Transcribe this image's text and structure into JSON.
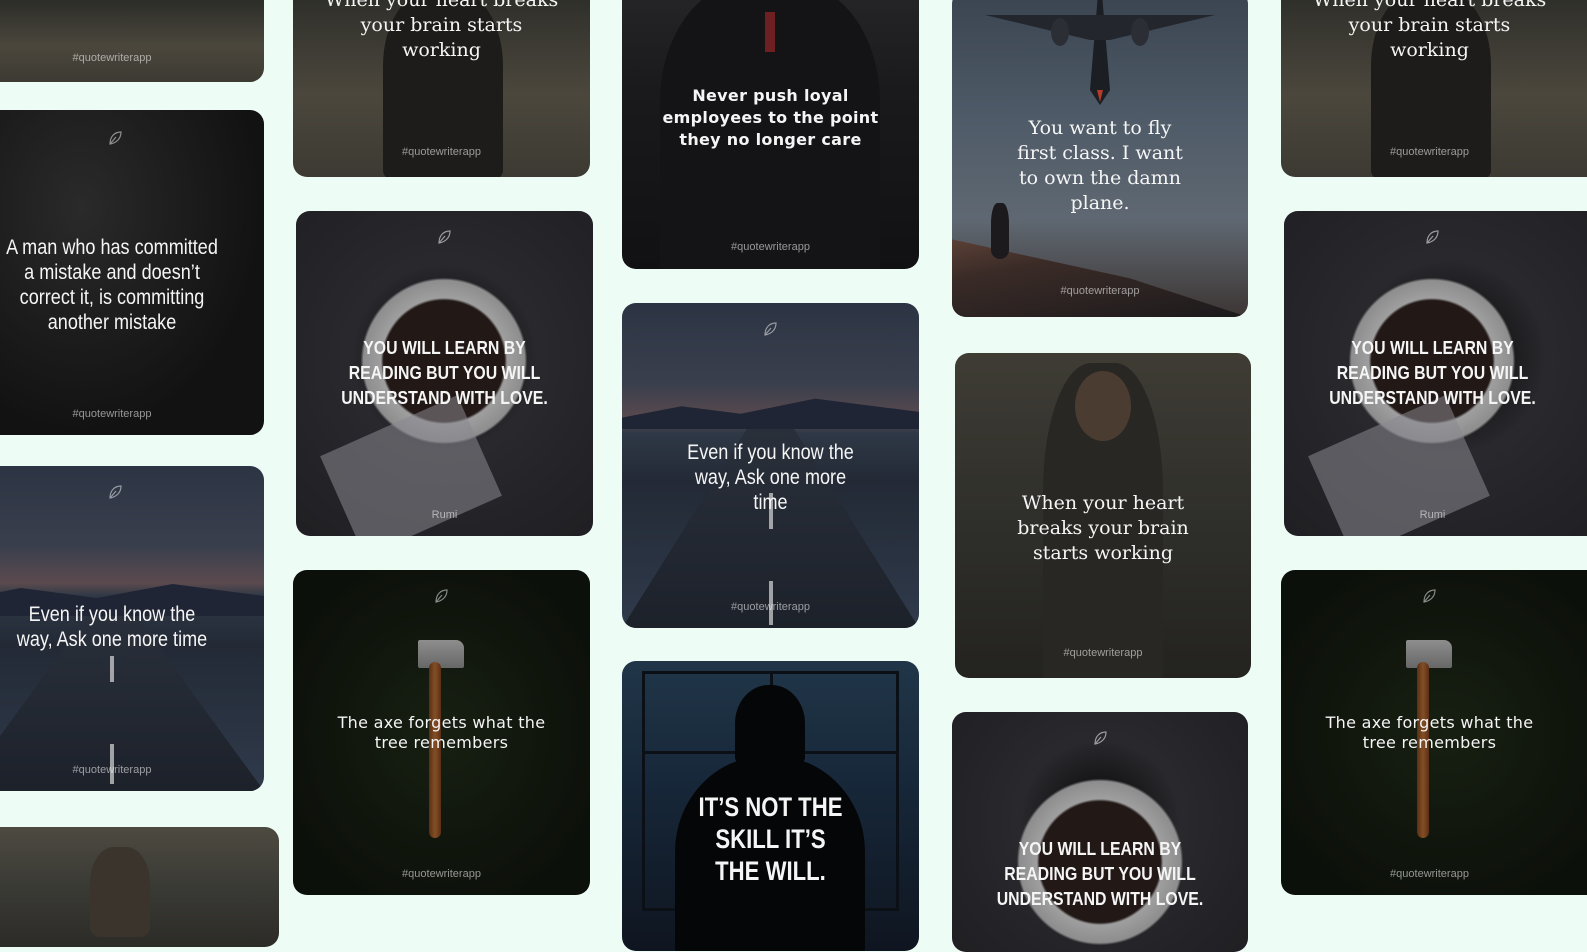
{
  "brand_tag": "#quotewriterapp",
  "cards": {
    "c1": {
      "text": "",
      "tag": "#quotewriterapp"
    },
    "c2": {
      "text": "A man who has committed a mistake and doesn’t correct it, is committing another mistake",
      "tag": "#quotewriterapp"
    },
    "c3": {
      "text": "Even if you know the way, Ask one more time",
      "tag": "#quotewriterapp"
    },
    "c4": {
      "text": "",
      "tag": ""
    },
    "c5": {
      "text": "When your heart breaks your brain starts working",
      "tag": "#quotewriterapp"
    },
    "c6": {
      "text": "YOU WILL LEARN BY READING BUT YOU WILL UNDERSTAND WITH LOVE.",
      "tag": "Rumi"
    },
    "c7": {
      "text": "The axe forgets what the tree remembers",
      "tag": "#quotewriterapp"
    },
    "c8": {
      "text": "Never push loyal employees to the point they no longer care",
      "tag": "#quotewriterapp"
    },
    "c9": {
      "text": "Even if you know the way, Ask one more time",
      "tag": "#quotewriterapp"
    },
    "c10": {
      "text": "IT’S NOT THE SKILL IT’S THE WILL.",
      "tag": ""
    },
    "c11": {
      "text": "You want to fly first class. I want to own the damn plane.",
      "tag": "#quotewriterapp"
    },
    "c12": {
      "text": "When your heart breaks your brain starts working",
      "tag": "#quotewriterapp"
    },
    "c13": {
      "text": "YOU WILL LEARN BY READING BUT YOU WILL UNDERSTAND WITH LOVE.",
      "tag": ""
    },
    "c14": {
      "text": "When your heart breaks your brain starts working",
      "tag": "#quotewriterapp"
    },
    "c15": {
      "text": "YOU WILL LEARN BY READING BUT YOU WILL UNDERSTAND WITH LOVE.",
      "tag": "Rumi"
    },
    "c16": {
      "text": "The axe forgets what the tree remembers",
      "tag": "#quotewriterapp"
    }
  },
  "icons": {
    "leaf": "leaf-icon"
  }
}
